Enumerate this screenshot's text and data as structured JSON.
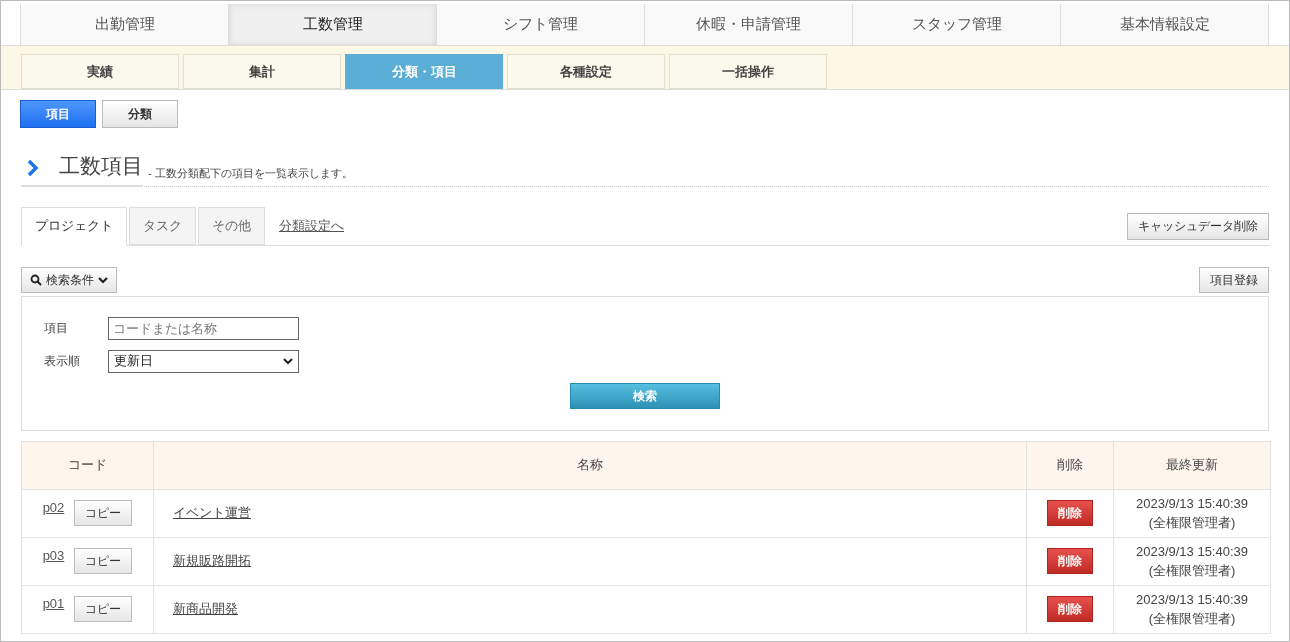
{
  "main_nav": [
    {
      "label": "出勤管理",
      "selected": false
    },
    {
      "label": "工数管理",
      "selected": true
    },
    {
      "label": "シフト管理",
      "selected": false
    },
    {
      "label": "休暇・申請管理",
      "selected": false
    },
    {
      "label": "スタッフ管理",
      "selected": false
    },
    {
      "label": "基本情報設定",
      "selected": false
    }
  ],
  "sub_nav": [
    {
      "label": "実績",
      "selected": false
    },
    {
      "label": "集計",
      "selected": false
    },
    {
      "label": "分類・項目",
      "selected": true
    },
    {
      "label": "各種設定",
      "selected": false
    },
    {
      "label": "一括操作",
      "selected": false
    }
  ],
  "mode_buttons": [
    {
      "label": "項目",
      "selected": true
    },
    {
      "label": "分類",
      "selected": false
    }
  ],
  "heading": {
    "title": "工数項目",
    "description": "- 工数分類配下の項目を一覧表示します。"
  },
  "tabs": [
    {
      "label": "プロジェクト",
      "selected": true
    },
    {
      "label": "タスク",
      "selected": false
    },
    {
      "label": "その他",
      "selected": false
    }
  ],
  "tab_link": "分類設定へ",
  "cache_button": "キャッシュデータ削除",
  "search_toggle": "検索条件",
  "register_button": "項目登録",
  "search_form": {
    "item_label": "項目",
    "item_placeholder": "コードまたは名称",
    "order_label": "表示順",
    "order_value": "更新日",
    "submit": "検索"
  },
  "table": {
    "columns": [
      "コード",
      "名称",
      "削除",
      "最終更新"
    ],
    "rows": [
      {
        "code": "p02",
        "copy": "コピー",
        "name": "イベント運営",
        "delete": "削除",
        "updated": "2023/9/13 15:40:39",
        "updater": "(全権限管理者)"
      },
      {
        "code": "p03",
        "copy": "コピー",
        "name": "新規販路開拓",
        "delete": "削除",
        "updated": "2023/9/13 15:40:39",
        "updater": "(全権限管理者)"
      },
      {
        "code": "p01",
        "copy": "コピー",
        "name": "新商品開発",
        "delete": "削除",
        "updated": "2023/9/13 15:40:39",
        "updater": "(全権限管理者)"
      }
    ]
  }
}
